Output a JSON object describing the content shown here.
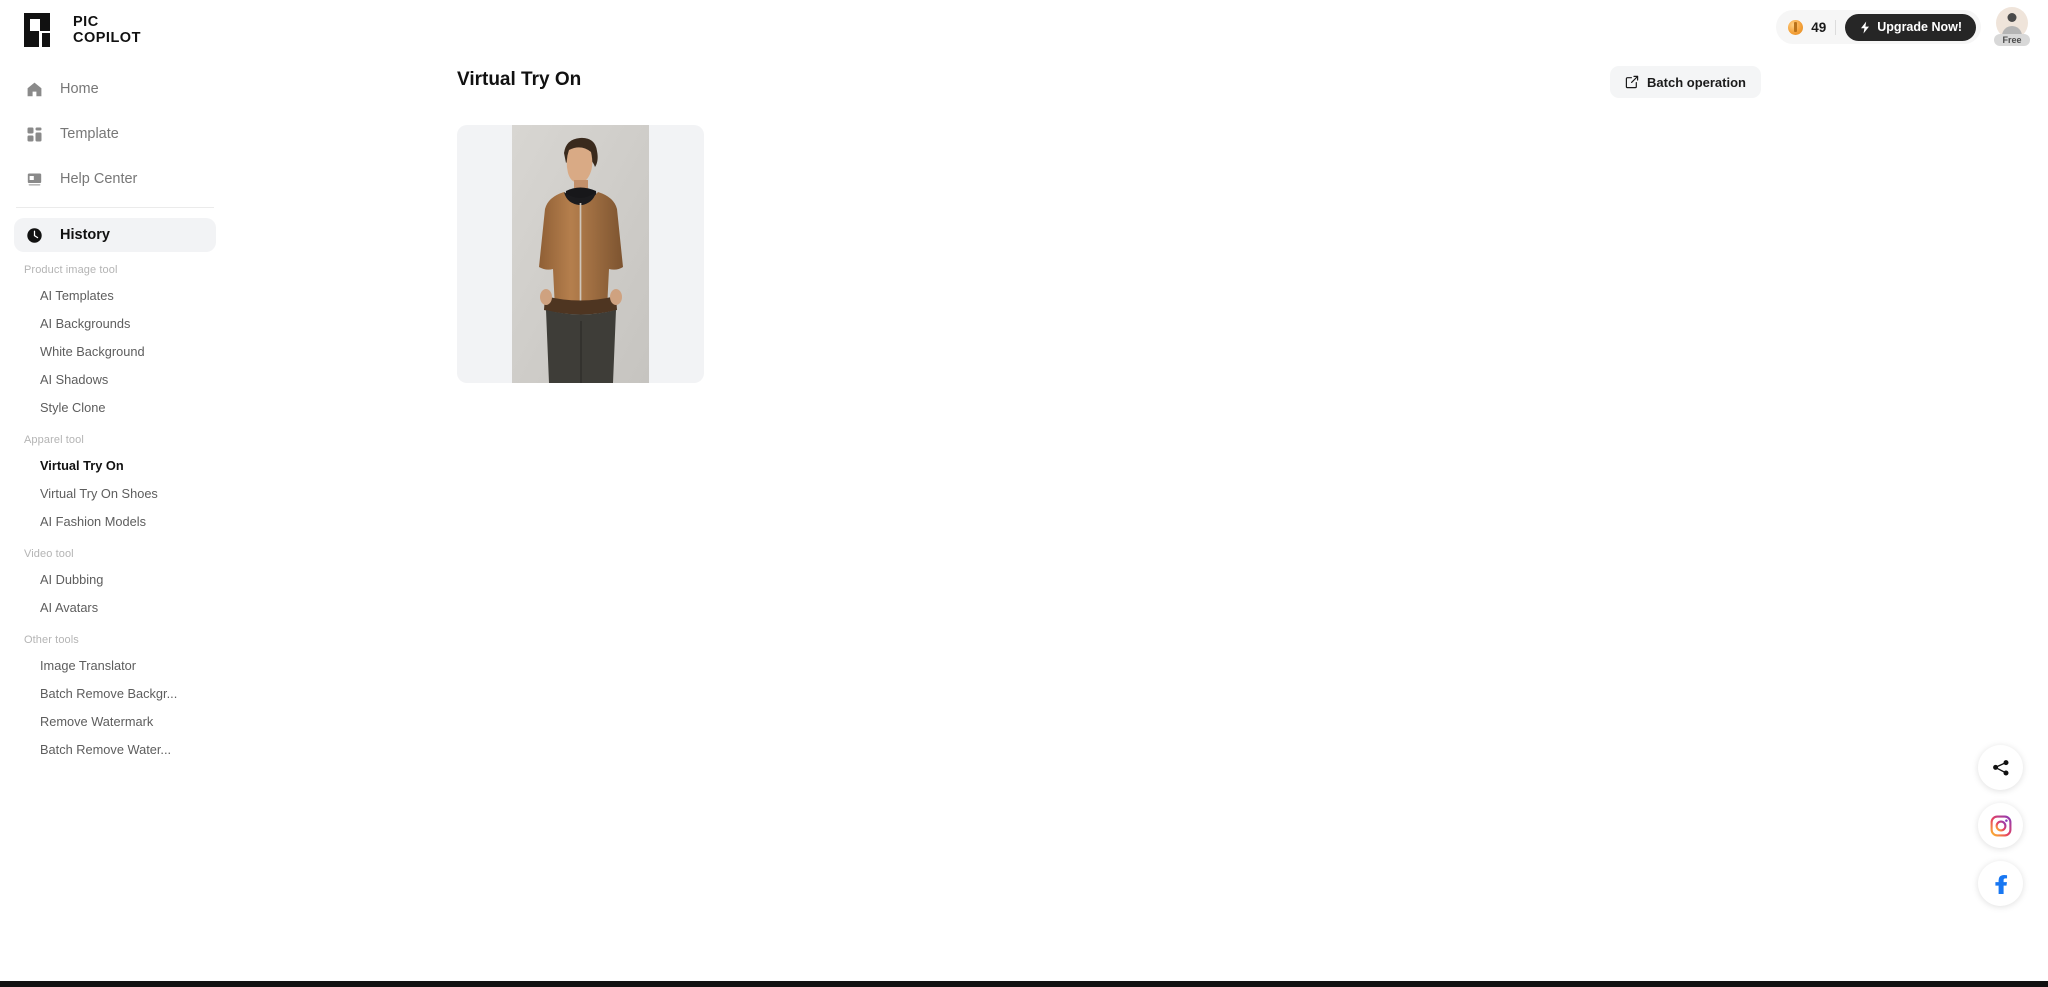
{
  "brand": {
    "line1": "PIC",
    "line2": "COPILOT",
    "logo_icon": "pic-copilot-logo"
  },
  "header": {
    "credits": "49",
    "coin_icon": "coin-icon",
    "upgrade_label": "Upgrade Now!",
    "upgrade_icon": "lightning-icon",
    "upgrade_bg": "#262626",
    "plan_badge": "Free",
    "avatar_icon": "user-avatar-icon"
  },
  "sidebar": {
    "nav": [
      {
        "label": "Home",
        "icon": "home-icon",
        "active": false
      },
      {
        "label": "Template",
        "icon": "grid-icon",
        "active": false
      },
      {
        "label": "Help Center",
        "icon": "book-icon",
        "active": false
      },
      {
        "label": "History",
        "icon": "clock-icon",
        "active": true
      }
    ],
    "groups": [
      {
        "title": "Product image tool",
        "items": [
          {
            "label": "AI Templates",
            "active": false
          },
          {
            "label": "AI Backgrounds",
            "active": false
          },
          {
            "label": "White Background",
            "active": false
          },
          {
            "label": "AI Shadows",
            "active": false
          },
          {
            "label": "Style Clone",
            "active": false
          }
        ]
      },
      {
        "title": "Apparel tool",
        "items": [
          {
            "label": "Virtual Try On",
            "active": true
          },
          {
            "label": "Virtual Try On Shoes",
            "active": false
          },
          {
            "label": "AI Fashion Models",
            "active": false
          }
        ]
      },
      {
        "title": "Video tool",
        "items": [
          {
            "label": "AI Dubbing",
            "active": false
          },
          {
            "label": "AI Avatars",
            "active": false
          }
        ]
      },
      {
        "title": "Other tools",
        "items": [
          {
            "label": "Image Translator",
            "active": false
          },
          {
            "label": "Batch Remove Backgr...",
            "active": false
          },
          {
            "label": "Remove Watermark",
            "active": false
          },
          {
            "label": "Batch Remove Water...",
            "active": false
          }
        ]
      }
    ]
  },
  "main": {
    "title": "Virtual Try On",
    "batch_label": "Batch operation",
    "batch_icon": "edit-square-icon",
    "results": [
      {
        "name": "virtual-try-on-result",
        "alt": "Male model wearing tan hooded zip jacket over black tee with dark trousers on light gray studio backdrop",
        "card_bg": "#f2f3f5"
      }
    ]
  },
  "social": [
    {
      "name": "share-icon",
      "label": "Share"
    },
    {
      "name": "instagram-icon",
      "label": "Instagram"
    },
    {
      "name": "facebook-icon",
      "label": "Facebook"
    }
  ]
}
